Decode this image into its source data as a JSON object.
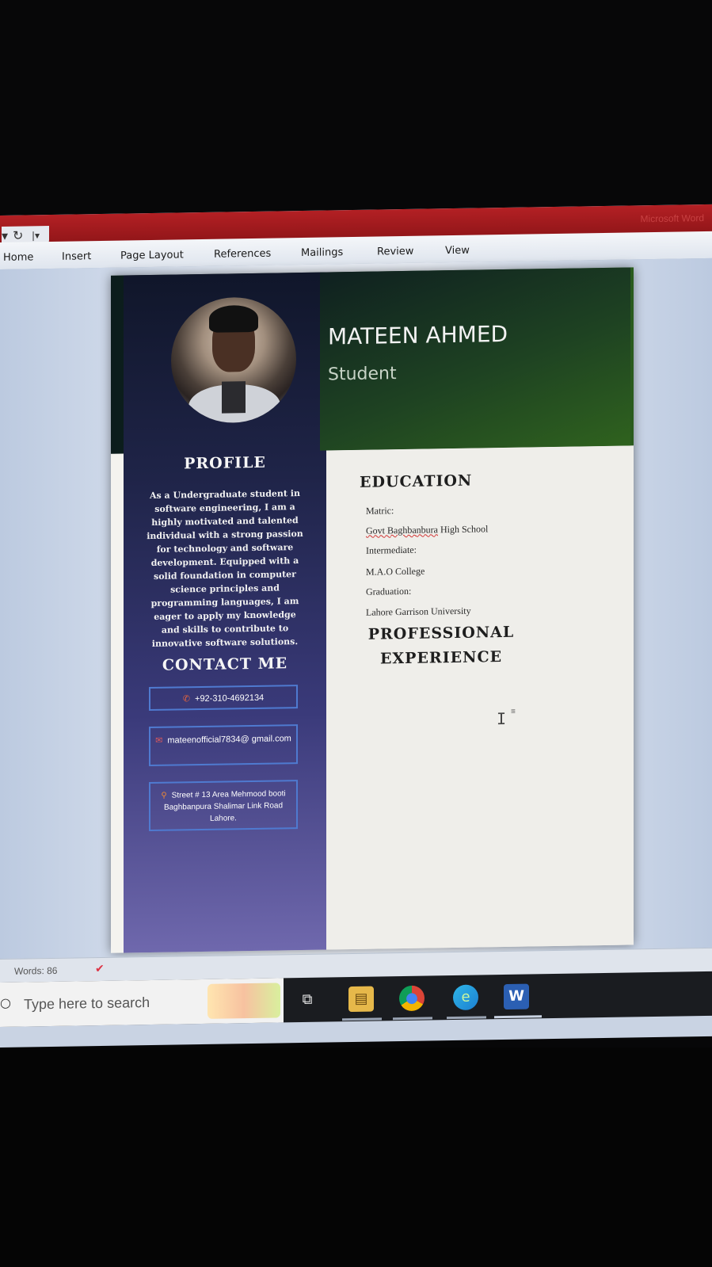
{
  "ribbon": {
    "tabs": [
      "Home",
      "Insert",
      "Page Layout",
      "References",
      "Mailings",
      "Review",
      "View"
    ]
  },
  "window": {
    "title_fragment": "Microsoft Word"
  },
  "resume": {
    "name": "MATEEN AHMED",
    "role": "Student",
    "profile_title": "PROFILE",
    "profile_text": "As a Undergraduate student in software engineering, I am a highly motivated and talented individual with a strong passion for technology and software development. Equipped with a solid foundation in computer science principles and programming languages, I am eager to apply my knowledge and skills to contribute to innovative software solutions.",
    "contact_title": "CONTACT ME",
    "phone": "+92-310-4692134",
    "email": "mateenofficial7834@ gmail.com",
    "address": "Street # 13 Area Mehmood booti Baghbanpura Shalimar Link Road Lahore.",
    "education_title": "EDUCATION",
    "education": {
      "matric_label": "Matric:",
      "matric_school_a": "Govt Baghbanbura",
      "matric_school_b": " High School",
      "inter_label": "Intermediate:",
      "inter_school": "M.A.O College",
      "grad_label": "Graduation:",
      "grad_school": "Lahore Garrison University"
    },
    "experience_title": "PROFESSIONAL EXPERIENCE"
  },
  "statusbar": {
    "words": "Words: 86"
  },
  "taskbar": {
    "search_placeholder": "Type here to search"
  },
  "icons": {
    "phone": "phone-icon",
    "mail": "mail-icon",
    "location": "location-pin-icon",
    "spell": "spelling-check-icon"
  }
}
